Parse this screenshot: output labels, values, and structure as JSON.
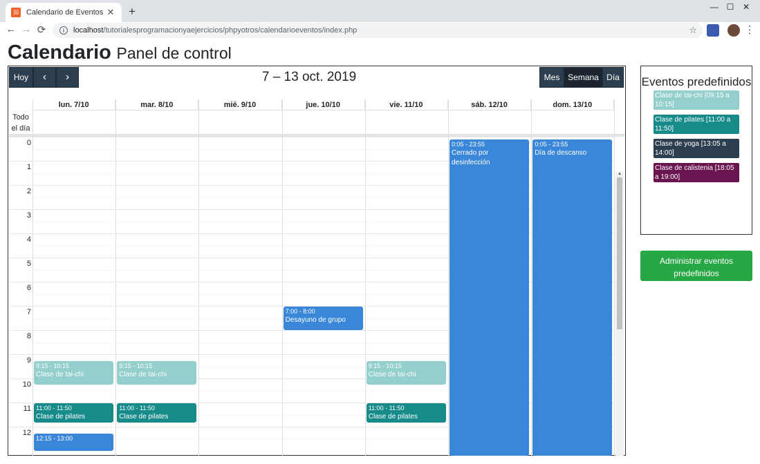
{
  "browser": {
    "tab_title": "Calendario de Eventos",
    "tab_close": "✕",
    "new_tab": "+",
    "url_host": "localhost",
    "url_path": "/tutorialesprogramacionyaejercicios/phpyotros/calendarioeventos/index.php",
    "win_min": "—",
    "win_max": "☐",
    "win_close": "✕",
    "back": "←",
    "forward": "→",
    "reload": "⟳",
    "star": "☆",
    "menu": "⋮"
  },
  "page": {
    "title": "Calendario",
    "subtitle": "Panel de control"
  },
  "calendar": {
    "today_label": "Hoy",
    "prev_label": "‹",
    "next_label": "›",
    "title": "7 – 13 oct. 2019",
    "views": [
      "Mes",
      "Semana",
      "Día"
    ],
    "active_view": "Semana",
    "days": [
      "lun. 7/10",
      "mar. 8/10",
      "mié. 9/10",
      "jue. 10/10",
      "vie. 11/10",
      "sáb. 12/10",
      "dom. 13/10"
    ],
    "allday_label": "Todo el día",
    "hours": [
      "0",
      "1",
      "2",
      "3",
      "4",
      "5",
      "6",
      "7",
      "8",
      "9",
      "10",
      "11",
      "12"
    ],
    "events": [
      {
        "day": 5,
        "start": 0.083,
        "end": 23.92,
        "time": "0:05 - 23:55",
        "title": "Cerrado por desinfección",
        "color": "#3a87d9"
      },
      {
        "day": 6,
        "start": 0.083,
        "end": 23.92,
        "time": "0:05 - 23:55",
        "title": "Día de descanso",
        "color": "#3a87d9"
      },
      {
        "day": 3,
        "start": 7.0,
        "end": 8.0,
        "time": "7:00 - 8:00",
        "title": "Desayuno de grupo",
        "color": "#3a87d9"
      },
      {
        "day": 0,
        "start": 9.25,
        "end": 10.25,
        "time": "9:15 - 10:15",
        "title": "Clase de tai-chi",
        "color": "#93cfcd"
      },
      {
        "day": 1,
        "start": 9.25,
        "end": 10.25,
        "time": "9:15 - 10:15",
        "title": "Clase de tai-chi",
        "color": "#93cfcd"
      },
      {
        "day": 4,
        "start": 9.25,
        "end": 10.25,
        "time": "9:15 - 10:15",
        "title": "Clase de tai-chi",
        "color": "#93cfcd"
      },
      {
        "day": 0,
        "start": 11.0,
        "end": 11.833,
        "time": "11:00 - 11:50",
        "title": "Clase de pilates",
        "color": "#178a8a"
      },
      {
        "day": 1,
        "start": 11.0,
        "end": 11.833,
        "time": "11:00 - 11:50",
        "title": "Clase de pilates",
        "color": "#178a8a"
      },
      {
        "day": 4,
        "start": 11.0,
        "end": 11.833,
        "time": "11:00 - 11:50",
        "title": "Clase de pilates",
        "color": "#178a8a"
      },
      {
        "day": 0,
        "start": 12.25,
        "end": 13.0,
        "time": "12:15 - 13:00",
        "title": "",
        "color": "#3a87d9"
      }
    ]
  },
  "sidebar": {
    "predef_title": "Eventos predefinidos",
    "predef_items": [
      {
        "label": "Clase de tai-chi [09:15 a 10:15]",
        "color": "#93cfcd"
      },
      {
        "label": "Clase de pilates [11:00 a 11:50]",
        "color": "#178a8a"
      },
      {
        "label": "Clase de yoga [13:05 a 14:00]",
        "color": "#2c3e50"
      },
      {
        "label": "Clase de calistenia [18:05 a 19:00]",
        "color": "#6a1450"
      }
    ],
    "admin_button": "Administrar eventos predefinidos"
  }
}
